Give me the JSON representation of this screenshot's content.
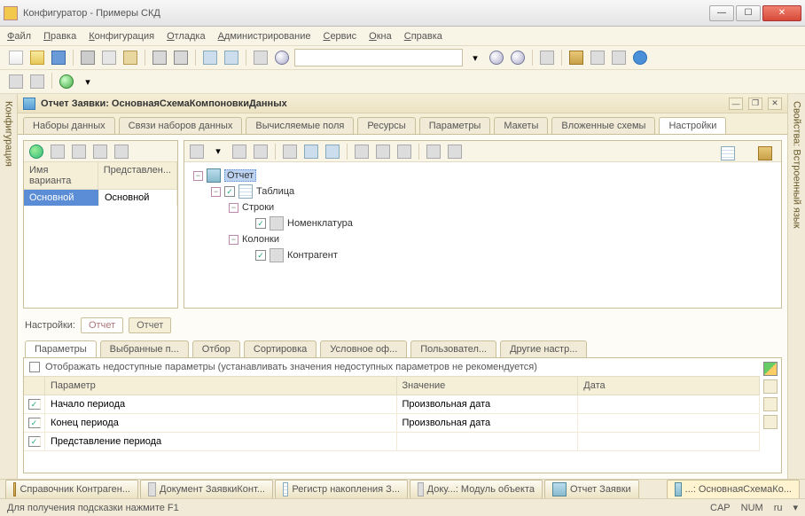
{
  "window": {
    "title": "Конфигуратор - Примеры СКД"
  },
  "menu": [
    "Файл",
    "Правка",
    "Конфигурация",
    "Отладка",
    "Администрирование",
    "Сервис",
    "Окна",
    "Справка"
  ],
  "mdi": {
    "title": "Отчет Заявки: ОсновнаяСхемаКомпоновкиДанных"
  },
  "tabs": [
    "Наборы данных",
    "Связи наборов данных",
    "Вычисляемые поля",
    "Ресурсы",
    "Параметры",
    "Макеты",
    "Вложенные схемы",
    "Настройки"
  ],
  "variants": {
    "headers": [
      "Имя варианта",
      "Представлен..."
    ],
    "rows": [
      {
        "name": "Основной",
        "repr": "Основной"
      }
    ]
  },
  "tree": {
    "root": "Отчет",
    "table": "Таблица",
    "rows_label": "Строки",
    "row_item": "Номенклатура",
    "cols_label": "Колонки",
    "col_item": "Контрагент"
  },
  "settings_label": "Настройки:",
  "settings_chips": [
    "Отчет",
    "Отчет"
  ],
  "subtabs": [
    "Параметры",
    "Выбранные п...",
    "Отбор",
    "Сортировка",
    "Условное оф...",
    "Пользовател...",
    "Другие настр..."
  ],
  "show_unavailable": "Отображать недоступные параметры (устанавливать значения недоступных параметров не рекомендуется)",
  "param_head": [
    "Параметр",
    "Значение",
    "Дата"
  ],
  "params": [
    {
      "name": "Начало периода",
      "value": "Произвольная дата",
      "date": ""
    },
    {
      "name": "Конец периода",
      "value": "Произвольная дата",
      "date": ""
    },
    {
      "name": "Представление периода",
      "value": "",
      "date": ""
    }
  ],
  "side_left": "Конфигурация",
  "side_right": "Свойства: Встроенный язык",
  "taskbar": [
    {
      "label": "Справочник Контраген..."
    },
    {
      "label": "Документ ЗаявкиКонт..."
    },
    {
      "label": "Регистр накопления З..."
    },
    {
      "label": "Доку...: Модуль объекта"
    },
    {
      "label": "Отчет Заявки"
    },
    {
      "label": "...: ОсновнаяСхемаКо..."
    }
  ],
  "status": {
    "hint": "Для получения подсказки нажмите F1",
    "cap": "CAP",
    "num": "NUM",
    "lang": "ru"
  }
}
